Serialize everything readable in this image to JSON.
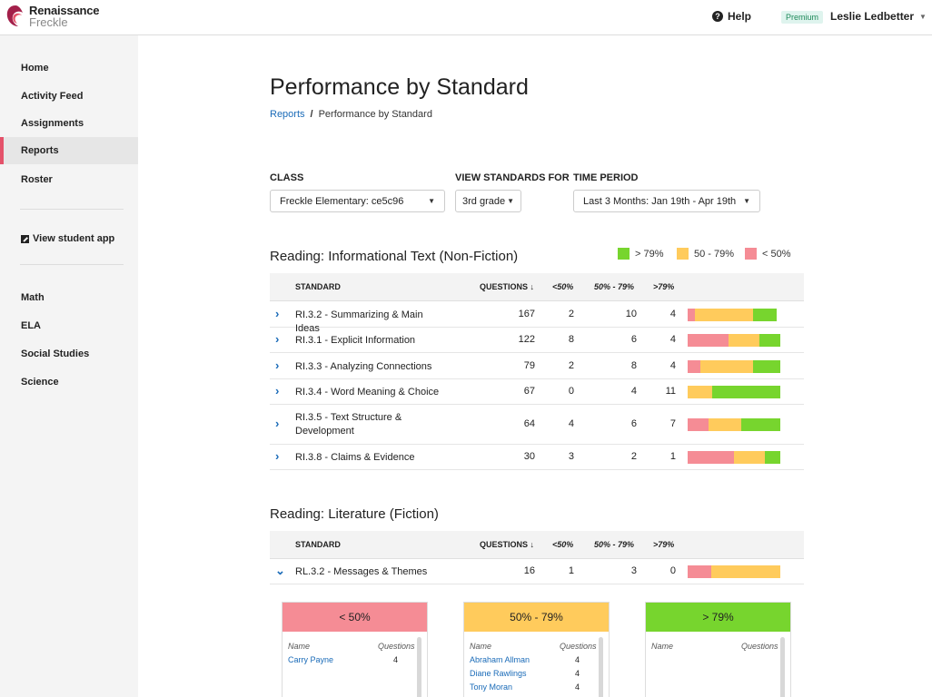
{
  "header": {
    "brand_line1": "Renaissance",
    "brand_line2": "Freckle",
    "help_label": "Help",
    "premium_badge": "Premium",
    "user_name": "Leslie Ledbetter"
  },
  "sidebar": {
    "items": [
      {
        "label": "Home"
      },
      {
        "label": "Activity Feed"
      },
      {
        "label": "Assignments"
      },
      {
        "label": "Reports",
        "active": true
      },
      {
        "label": "Roster"
      }
    ],
    "view_student_app": "View student app",
    "subjects": [
      {
        "label": "Math"
      },
      {
        "label": "ELA"
      },
      {
        "label": "Social Studies"
      },
      {
        "label": "Science"
      }
    ]
  },
  "page": {
    "title": "Performance by Standard",
    "breadcrumb_link": "Reports",
    "breadcrumb_sep": "/",
    "breadcrumb_current": "Performance by Standard"
  },
  "filters": {
    "class_label": "CLASS",
    "class_value": "Freckle Elementary: ce5c96",
    "standards_label": "VIEW STANDARDS FOR",
    "standards_value": "3rd grade",
    "period_label": "TIME PERIOD",
    "period_value": "Last 3 Months: Jan 19th - Apr 19th"
  },
  "legend": {
    "high": "> 79%",
    "mid": "50 - 79%",
    "low": "< 50%"
  },
  "colors": {
    "low": "#f58c95",
    "mid": "#ffcb5c",
    "high": "#77d52e",
    "accent": "#e4526a",
    "link": "#1a6bb8"
  },
  "table_headers": {
    "standard": "STANDARD",
    "questions": "QUESTIONS ↓",
    "low": "<50%",
    "mid": "50% - 79%",
    "high": ">79%"
  },
  "sections": [
    {
      "title": "Reading: Informational Text (Non-Fiction)",
      "rows": [
        {
          "standard": "RI.3.2 - Summarizing & Main Ideas",
          "questions": "167",
          "low": "2",
          "mid": "10",
          "high": "4",
          "bar": [
            8,
            63,
            25
          ]
        },
        {
          "standard": "RI.3.1 - Explicit Information",
          "questions": "122",
          "low": "8",
          "mid": "6",
          "high": "4",
          "bar": [
            44,
            33,
            23
          ]
        },
        {
          "standard": "RI.3.3 - Analyzing Connections",
          "questions": "79",
          "low": "2",
          "mid": "8",
          "high": "4",
          "bar": [
            14,
            57,
            29
          ]
        },
        {
          "standard": "RI.3.4 - Word Meaning & Choice",
          "questions": "67",
          "low": "0",
          "mid": "4",
          "high": "11",
          "bar": [
            0,
            26,
            74
          ]
        },
        {
          "standard": "RI.3.5 - Text Structure & Development",
          "questions": "64",
          "low": "4",
          "mid": "6",
          "high": "7",
          "bar": [
            23,
            35,
            42
          ]
        },
        {
          "standard": "RI.3.8 - Claims & Evidence",
          "questions": "30",
          "low": "3",
          "mid": "2",
          "high": "1",
          "bar": [
            50,
            33,
            17
          ]
        }
      ]
    },
    {
      "title": "Reading: Literature (Fiction)",
      "rows": [
        {
          "standard": "RL.3.2 - Messages & Themes",
          "questions": "16",
          "low": "1",
          "mid": "3",
          "high": "0",
          "bar": [
            25,
            75,
            0
          ]
        }
      ]
    }
  ],
  "breakdown": {
    "col_name": "Name",
    "col_questions": "Questions",
    "cards": [
      {
        "title": "< 50%",
        "students": [
          {
            "name": "Carry Payne",
            "questions": "4"
          }
        ]
      },
      {
        "title": "50% - 79%",
        "students": [
          {
            "name": "Abraham Allman",
            "questions": "4"
          },
          {
            "name": "Diane Rawlings",
            "questions": "4"
          },
          {
            "name": "Tony Moran",
            "questions": "4"
          }
        ]
      },
      {
        "title": "> 79%",
        "students": []
      }
    ]
  }
}
